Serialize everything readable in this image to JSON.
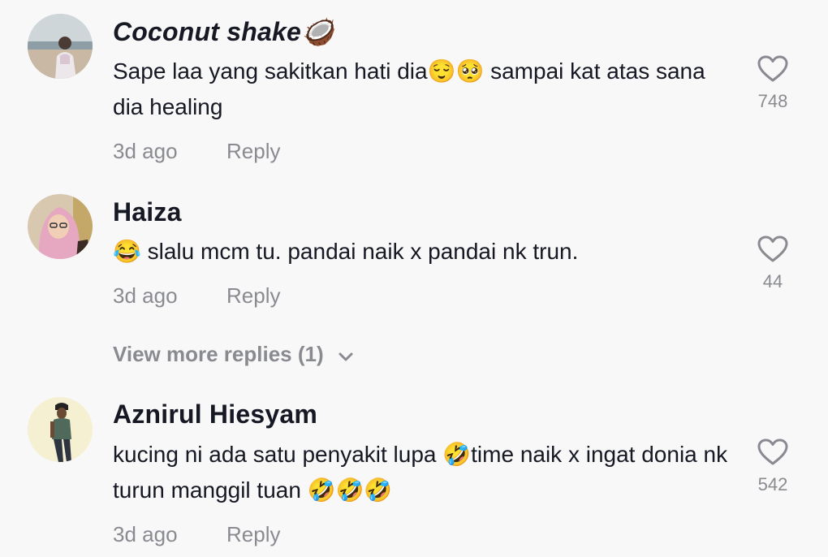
{
  "comments": [
    {
      "username": "Coconut shake🥥",
      "text": "Sape laa yang sakitkan hati dia😌🥺 sampai kat atas sana dia healing",
      "time": "3d ago",
      "reply_label": "Reply",
      "likes": "748",
      "avatar_icon": "beach-photo-avatar"
    },
    {
      "username": "Haiza",
      "text": "😂 slalu mcm tu. pandai naik x pandai nk trun.",
      "time": "3d ago",
      "reply_label": "Reply",
      "likes": "44",
      "avatar_icon": "hijab-photo-avatar"
    },
    {
      "username": "Aznirul Hiesyam",
      "text": "kucing ni ada satu penyakit lupa 🤣time naik x ingat donia nk turun manggil tuan 🤣🤣🤣",
      "time": "3d ago",
      "reply_label": "Reply",
      "likes": "542",
      "avatar_icon": "man-cap-photo-avatar"
    }
  ],
  "view_more": {
    "label": "View more replies (1)",
    "icon": "chevron-down-icon"
  },
  "colors": {
    "background": "#f8f8f8",
    "primary_text": "#161823",
    "secondary_text": "#8a8b91"
  }
}
